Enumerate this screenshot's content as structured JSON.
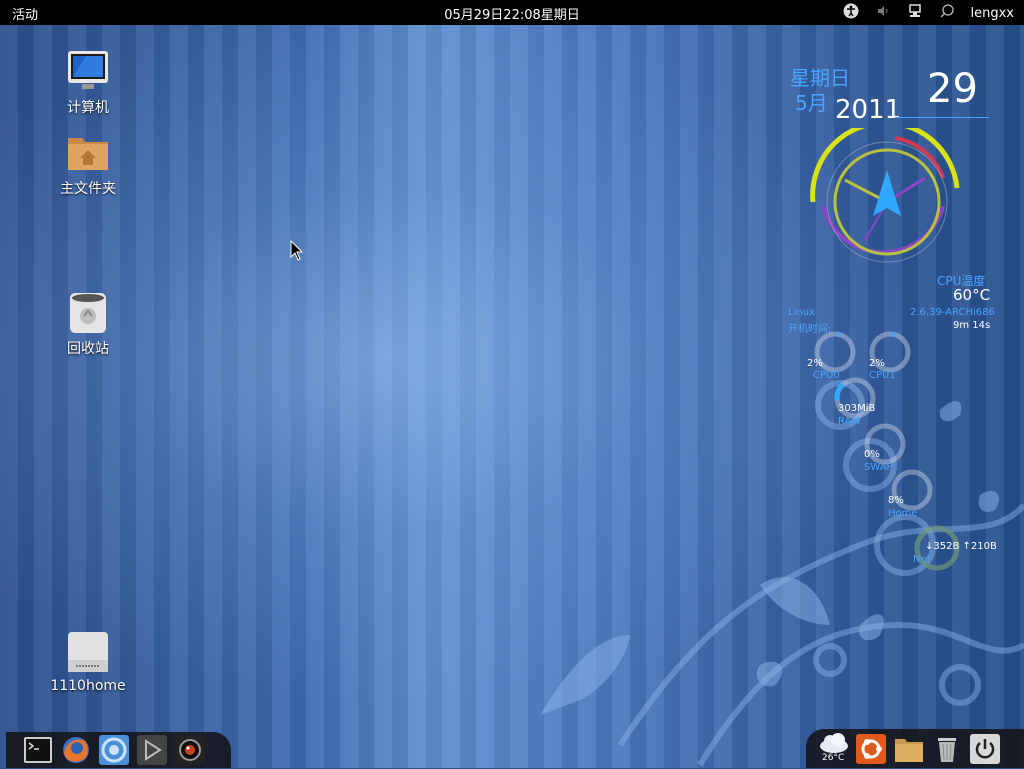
{
  "topbar": {
    "activities": "活动",
    "clock": "05月29日22:08星期日",
    "tray_icons": [
      "accessibility-icon",
      "volume-icon",
      "network-icon",
      "search-icon"
    ],
    "user": "lengxx"
  },
  "desktop_icons": [
    {
      "label": "计算机",
      "icon": "computer-icon"
    },
    {
      "label": "主文件夹",
      "icon": "home-folder-icon"
    },
    {
      "label": "回收站",
      "icon": "trash-icon"
    },
    {
      "label": "1110home",
      "icon": "drive-icon"
    }
  ],
  "widget": {
    "weekday": "星期日",
    "month": "5月",
    "year": "2011",
    "day": "29",
    "cpu_temp_label": "CPU温度",
    "cpu_temp_value": "60°C",
    "os_label": "Linux",
    "kernel": "2.6.39-ARCHi686",
    "uptime_label": "开机时间:",
    "uptime_value": "9m 14s",
    "cpu0_pct": "2%",
    "cpu0_label": "CPU0",
    "cpu1_pct": "2%",
    "cpu1_label": "CPU1",
    "ram_value": "303MiB",
    "ram_label": "RAM",
    "swap_pct": "0%",
    "swap_label": "SWAP",
    "home_pct": "8%",
    "home_label": "Home",
    "net_value": "↓352B ↑210B",
    "net_label": "Net",
    "accent_color": "#4aa3ff"
  },
  "dock": {
    "left_items": [
      "terminal-icon",
      "firefox-icon",
      "chromium-icon",
      "media-player-icon",
      "camera-icon"
    ],
    "weather_temp": "26°C",
    "right_items": [
      "weather-icon",
      "ubuntu-icon",
      "files-icon",
      "trash-icon",
      "power-icon"
    ]
  }
}
